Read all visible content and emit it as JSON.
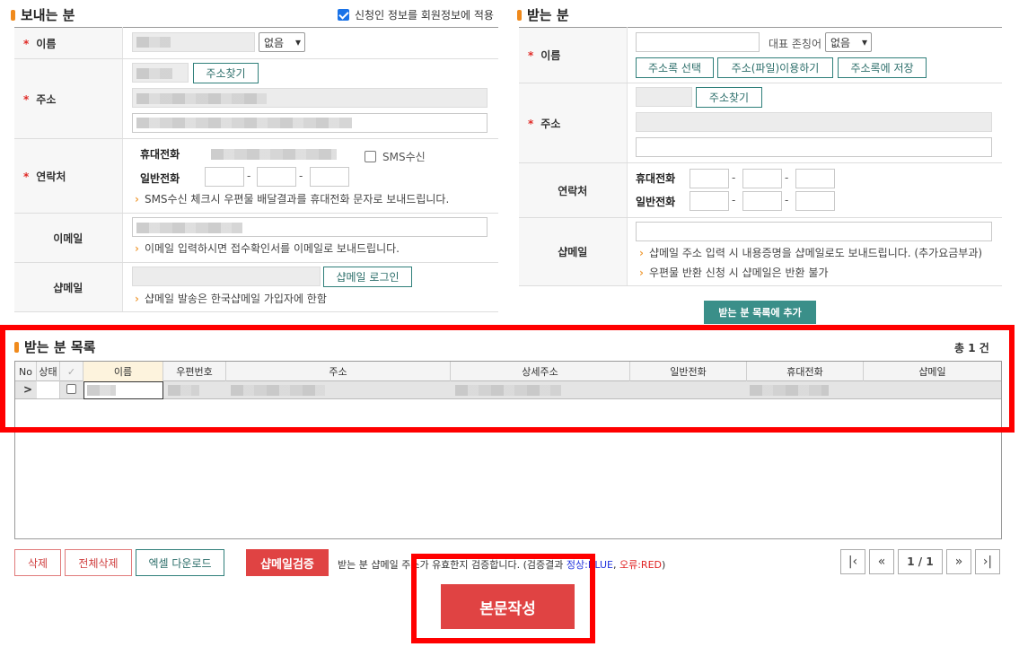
{
  "sender": {
    "title": "보내는 분",
    "apply_member_label": "신청인 정보를 회원정보에 적용",
    "name_label": "이름",
    "name_select": "없음",
    "address_label": "주소",
    "find_address_btn": "주소찾기",
    "contact_label": "연락처",
    "mobile_label": "휴대전화",
    "phone_label": "일반전화",
    "sms_label": "SMS수신",
    "sms_tip": "SMS수신 체크시 우편물 배달결과를 휴대전화 문자로 보내드립니다.",
    "email_label": "이메일",
    "email_tip": "이메일 입력하시면 접수확인서를 이메일로 보내드립니다.",
    "shopmail_label": "샵메일",
    "shopmail_login_btn": "샵메일 로그인",
    "shopmail_tip": "샵메일 발송은 한국샵메일 가입자에 한함"
  },
  "receiver": {
    "title": "받는 분",
    "name_label": "이름",
    "honorific_label": "대표 존칭어",
    "honorific_select": "없음",
    "addr_select_btn": "주소록 선택",
    "addr_file_btn": "주소(파일)이용하기",
    "addr_save_btn": "주소록에 저장",
    "address_label": "주소",
    "find_address_btn": "주소찾기",
    "contact_label": "연락처",
    "mobile_label": "휴대전화",
    "phone_label": "일반전화",
    "shopmail_label": "샵메일",
    "shopmail_tip1": "샵메일 주소 입력 시 내용증명을 샵메일로도 보내드립니다. (추가요금부과)",
    "shopmail_tip2": "우편물 반환 신청 시 샵메일은 반환 불가",
    "add_btn": "받는 분 목록에 추가"
  },
  "list": {
    "title": "받는 분 목록",
    "total": "총 1 건",
    "columns": [
      "No",
      "상태",
      "✓",
      "이름",
      "우편번호",
      "주소",
      "상세주소",
      "일반전화",
      "휴대전화",
      "샵메일"
    ],
    "row_marker": ">"
  },
  "footer": {
    "delete_btn": "삭제",
    "delete_all_btn": "전체삭제",
    "excel_btn": "엑셀 다운로드",
    "verify_btn": "샵메일검증",
    "verify_desc": "받는 분 샵메일 주소가 유효한지 검증합니다. (검증결과",
    "ok_text": "정상:BLUE",
    "err_text": "오류:RED",
    "close_paren": ")",
    "page_info": "1 / 1",
    "compose_btn": "본문작성"
  },
  "colors": {
    "accent_orange": "#f08a1c",
    "teal": "#3a8f89",
    "red_button": "#e04343",
    "highlight": "#ff0000"
  }
}
